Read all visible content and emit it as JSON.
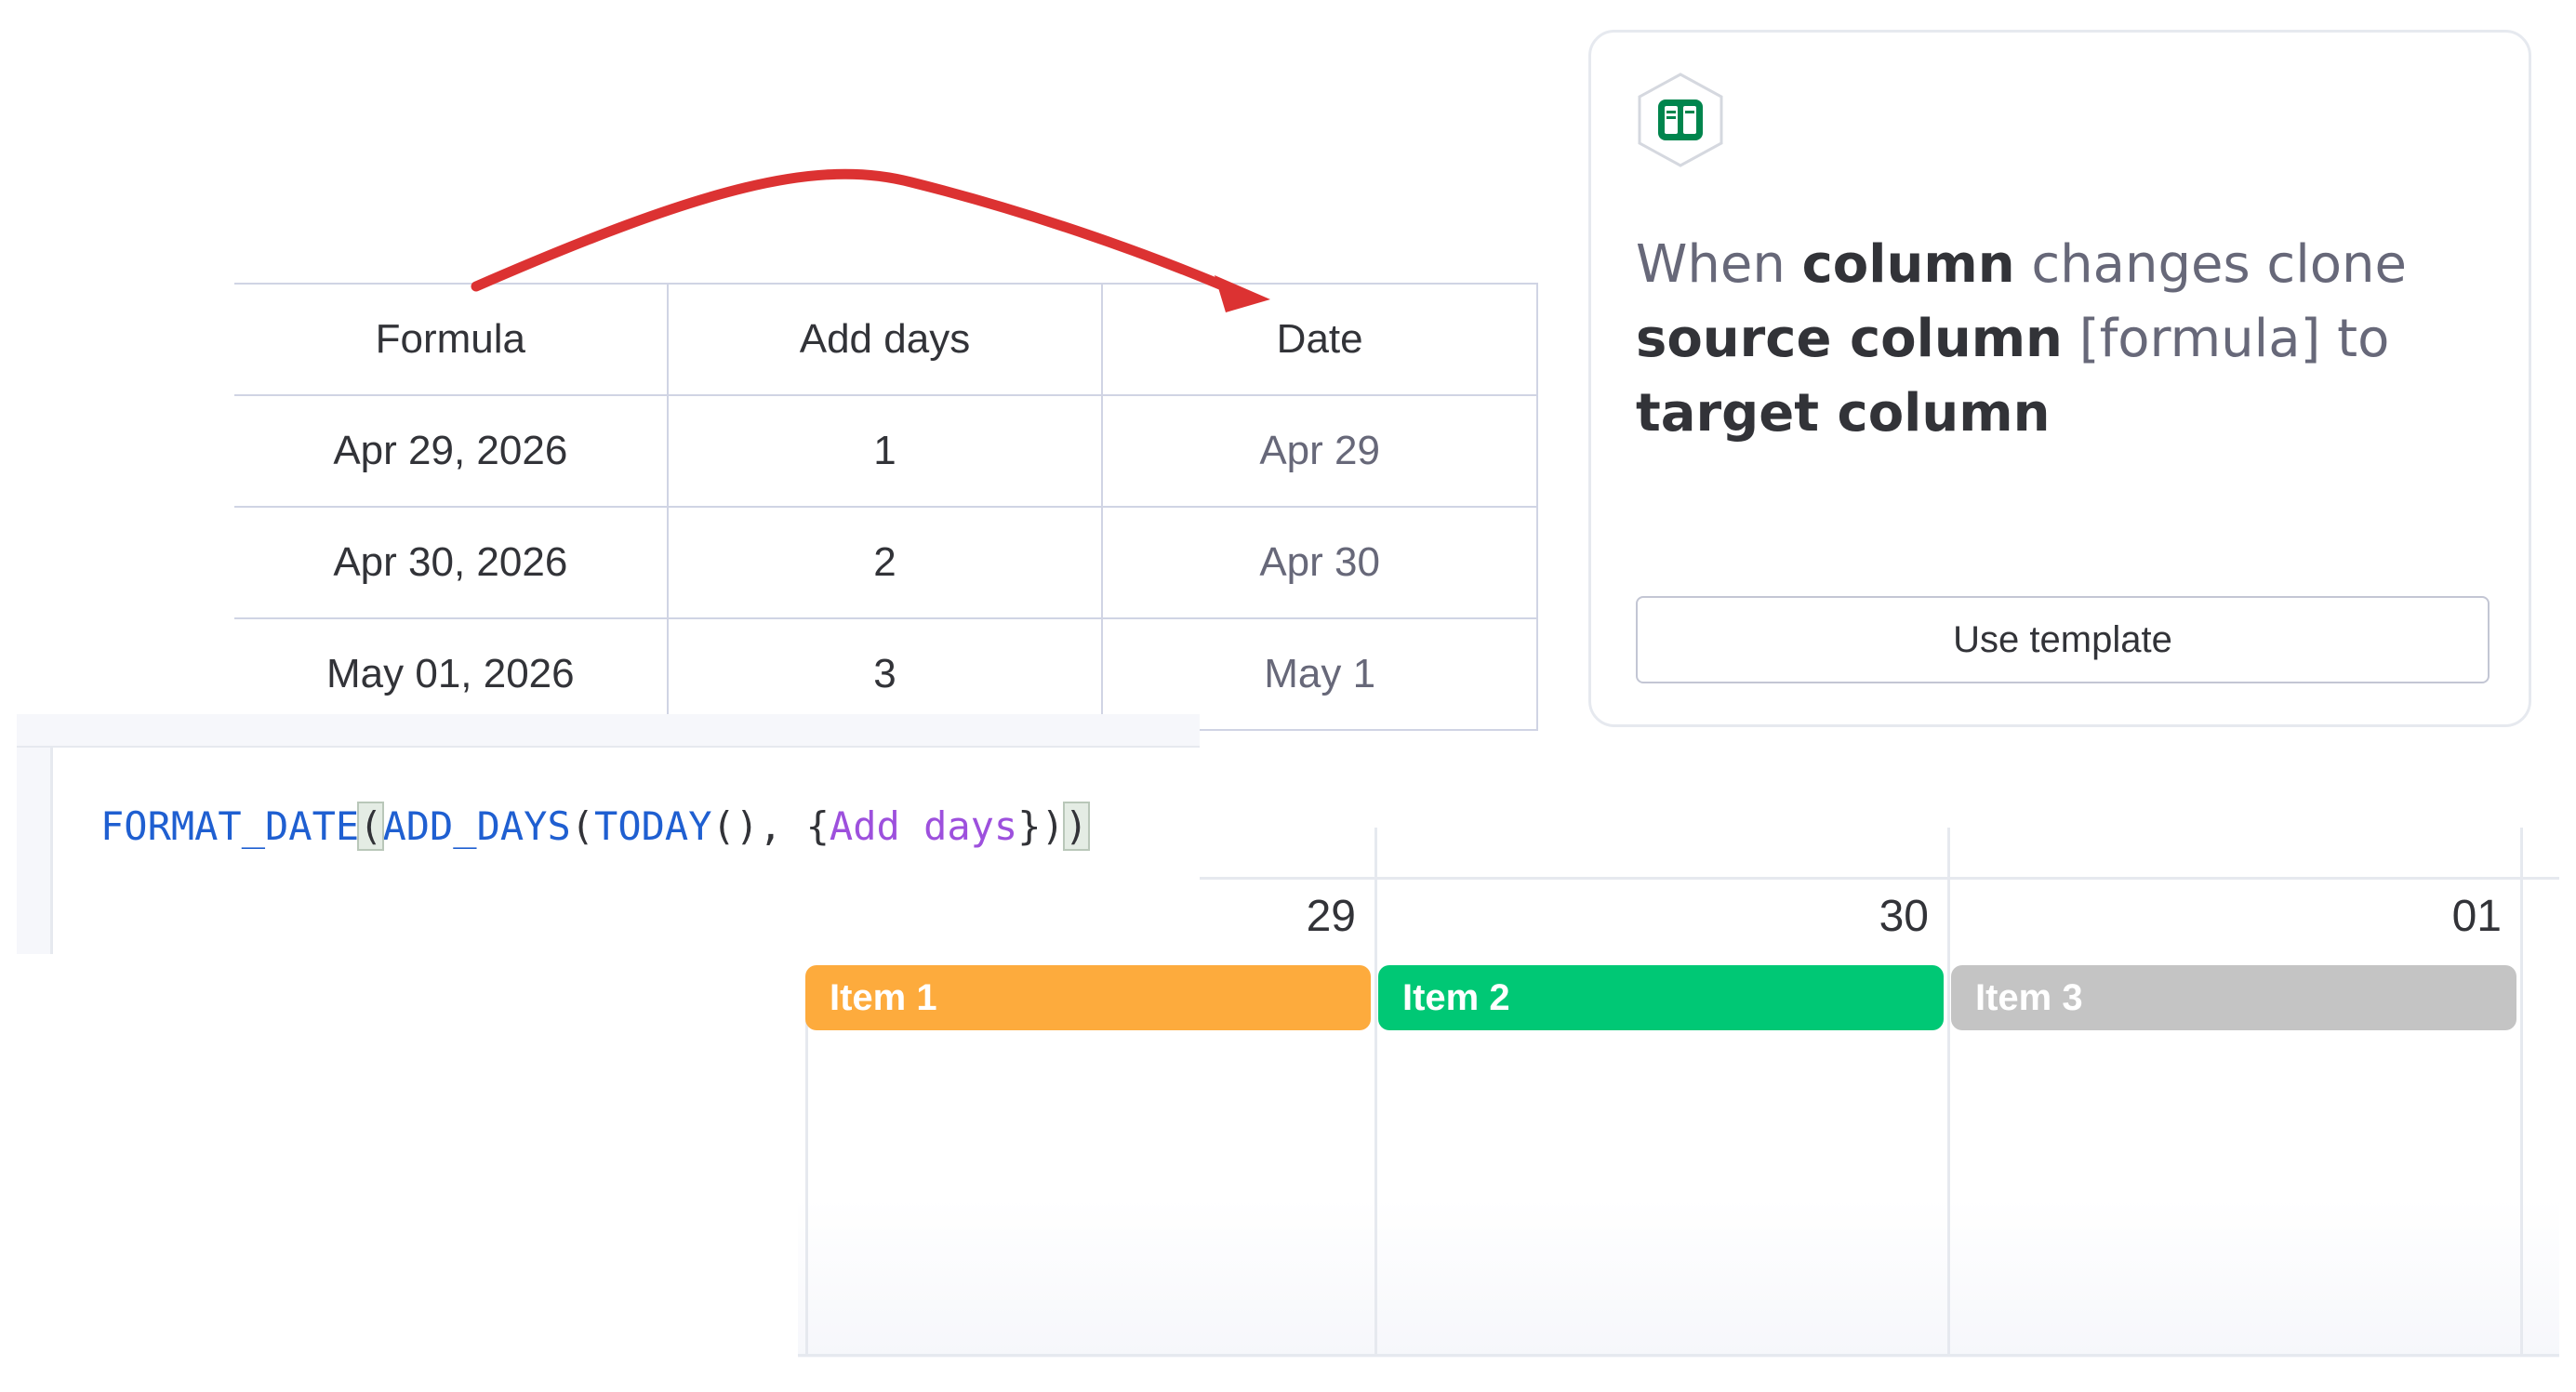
{
  "table": {
    "headers": [
      "Formula",
      "Add days",
      "Date"
    ],
    "rows": [
      {
        "formula": "Apr 29, 2026",
        "add_days": "1",
        "date": "Apr 29"
      },
      {
        "formula": "Apr 30, 2026",
        "add_days": "2",
        "date": "Apr 30"
      },
      {
        "formula": "May 01, 2026",
        "add_days": "3",
        "date": "May 1"
      }
    ]
  },
  "arrow": {
    "color": "#dc3232"
  },
  "template_card": {
    "icon": "board-columns-icon",
    "recipe": {
      "w1": "When ",
      "b1": "column",
      "w2": " changes clone ",
      "b2": "source column",
      "w3": " [formula] to ",
      "b3": "target column"
    },
    "button_label": "Use template"
  },
  "formula": {
    "tokens": [
      {
        "text": "FORMAT_DATE",
        "kind": "fn"
      },
      {
        "text": "(",
        "kind": "match"
      },
      {
        "text": "ADD_DAYS",
        "kind": "fn"
      },
      {
        "text": "(",
        "kind": "punc"
      },
      {
        "text": "TODAY",
        "kind": "fn"
      },
      {
        "text": "(), {",
        "kind": "punc"
      },
      {
        "text": "Add days",
        "kind": "col"
      },
      {
        "text": "})",
        "kind": "punc"
      },
      {
        "text": ")",
        "kind": "match"
      }
    ]
  },
  "calendar": {
    "days": [
      "29",
      "30",
      "01"
    ],
    "items": [
      {
        "label": "Item 1",
        "color": "#fdab3d"
      },
      {
        "label": "Item 2",
        "color": "#00c875"
      },
      {
        "label": "Item 3",
        "color": "#c4c4c4"
      }
    ]
  }
}
